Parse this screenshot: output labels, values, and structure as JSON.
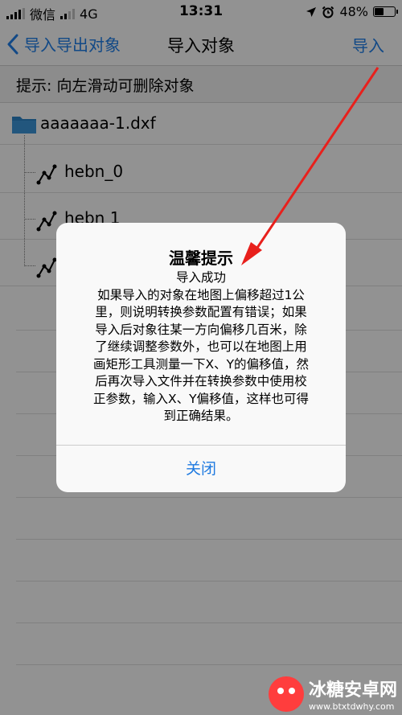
{
  "status_bar": {
    "carrier": "微信",
    "network": "4G",
    "time": "13:31",
    "battery_percent_label": "48%",
    "battery_level": 0.48
  },
  "nav": {
    "back_label": "导入导出对象",
    "title": "导入对象",
    "action_label": "导入"
  },
  "hint": "提示: 向左滑动可删除对象",
  "tree": {
    "file_name": "aaaaaaa-1.dxf",
    "layers": [
      "hebn_0",
      "hebn 1"
    ]
  },
  "dialog": {
    "title": "温馨提示",
    "lines": [
      "导入成功",
      "如果导入的对象在地图上偏移超过1公",
      "里，则说明转换参数配置有错误；如果",
      "导入后对象往某一方向偏移几百米，除",
      "了继续调整参数外，也可以在地图上用",
      "画矩形工具测量一下X、Y的偏移值，然",
      "后再次导入文件并在转换参数中使用校",
      "正参数，输入X、Y偏移值，这样也可得",
      "到正确结果。"
    ],
    "button_label": "关闭"
  },
  "watermark": {
    "name": "冰糖安卓网",
    "url": "www.btxtdwhy.com"
  },
  "colors": {
    "accent": "#1f7ae0",
    "annotation": "#e8201c",
    "folder": "#2a7fc0"
  }
}
